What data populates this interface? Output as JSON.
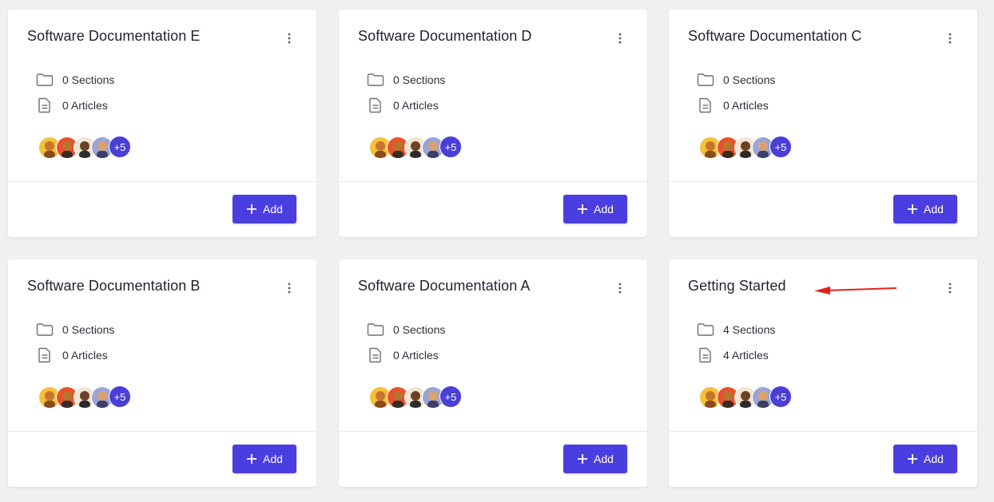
{
  "colors": {
    "accent": "#4b3ee0",
    "more_badge": "#4a3fd6",
    "annotation_arrow": "#e5221a"
  },
  "icons": {
    "sections": "folder-icon",
    "articles": "document-icon",
    "menu": "kebab-menu-icon",
    "add": "plus-icon"
  },
  "cards": [
    {
      "title": "Software Documentation E",
      "sections": "0 Sections",
      "articles": "0 Articles",
      "more_count": "+5",
      "add_label": "Add"
    },
    {
      "title": "Software Documentation D",
      "sections": "0 Sections",
      "articles": "0 Articles",
      "more_count": "+5",
      "add_label": "Add"
    },
    {
      "title": "Software Documentation C",
      "sections": "0 Sections",
      "articles": "0 Articles",
      "more_count": "+5",
      "add_label": "Add"
    },
    {
      "title": "Software Documentation B",
      "sections": "0 Sections",
      "articles": "0 Articles",
      "more_count": "+5",
      "add_label": "Add"
    },
    {
      "title": "Software Documentation A",
      "sections": "0 Sections",
      "articles": "0 Articles",
      "more_count": "+5",
      "add_label": "Add"
    },
    {
      "title": "Getting Started",
      "sections": "4 Sections",
      "articles": "4 Articles",
      "more_count": "+5",
      "add_label": "Add"
    }
  ]
}
